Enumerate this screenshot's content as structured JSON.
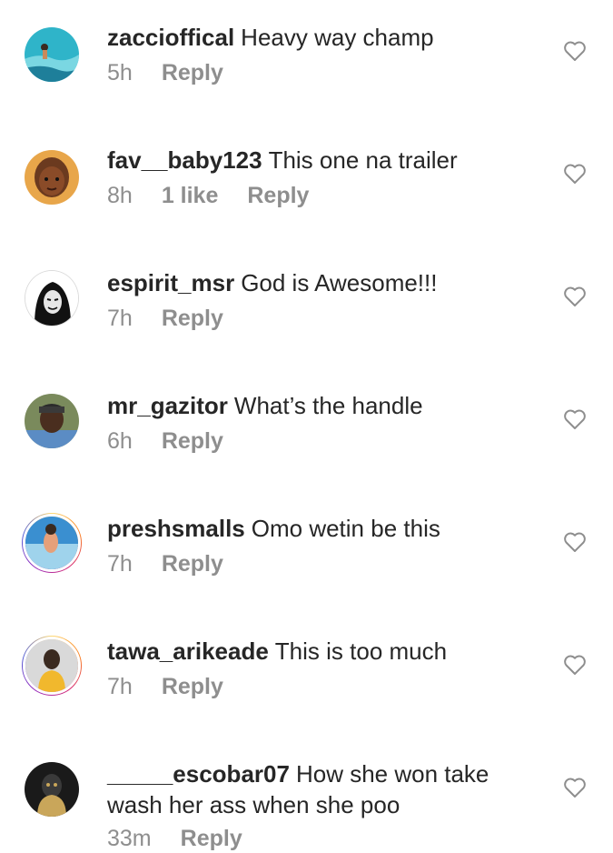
{
  "comments": [
    {
      "username": "zaccioffical",
      "text": "Heavy way champ",
      "time": "5h",
      "likes": "",
      "reply_label": "Reply",
      "avatar_colors": [
        "#2fb4c9",
        "#7ad7e2",
        "#1e7f9a"
      ]
    },
    {
      "username": "fav__baby123",
      "text": "This one na trailer",
      "time": "8h",
      "likes": "1 like",
      "reply_label": "Reply",
      "avatar_colors": [
        "#e8a64a",
        "#6b3a1f",
        "#f3c36b"
      ]
    },
    {
      "username": "espirit_msr",
      "text": "God is Awesome!!!",
      "time": "7h",
      "likes": "",
      "reply_label": "Reply",
      "avatar_colors": [
        "#ffffff",
        "#111111",
        "#e6e6e6"
      ]
    },
    {
      "username": "mr_gazitor",
      "text": "What’s the handle",
      "time": "6h",
      "likes": "",
      "reply_label": "Reply",
      "avatar_colors": [
        "#7a8a5c",
        "#4a2e1f",
        "#5b8cc4"
      ]
    },
    {
      "username": "preshsmalls",
      "text": "Omo wetin be this",
      "time": "7h",
      "likes": "",
      "reply_label": "Reply",
      "avatar_colors": [
        "#3a8fd0",
        "#9fd3ec",
        "#e5a07a"
      ]
    },
    {
      "username": "tawa_arikeade",
      "text": "This is too much",
      "time": "7h",
      "likes": "",
      "reply_label": "Reply",
      "avatar_colors": [
        "#d9d9d9",
        "#3a2a20",
        "#f1b82d"
      ]
    },
    {
      "username": "_____escobar07",
      "text": "How she won take wash her ass when she poo",
      "time": "33m",
      "likes": "",
      "reply_label": "Reply",
      "avatar_colors": [
        "#1a1a1a",
        "#c9a65a",
        "#3a3a3a"
      ]
    }
  ]
}
